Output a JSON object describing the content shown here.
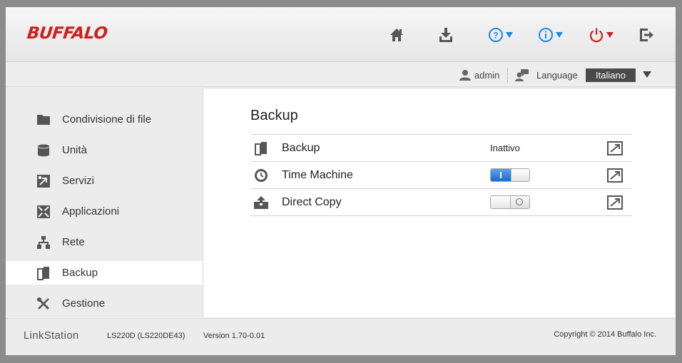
{
  "brand": {
    "logo_text": "BUFFALO",
    "accent_color": "#cc1f1f"
  },
  "header": {
    "icons": [
      "home-icon",
      "download-icon",
      "help-icon",
      "info-icon",
      "power-icon",
      "logout-icon"
    ],
    "link_color": "#1e88e5"
  },
  "userbar": {
    "user": "admin",
    "language_label": "Language",
    "language_value": "Italiano"
  },
  "sidebar": {
    "items": [
      {
        "label": "Condivisione di file",
        "icon": "folder-icon"
      },
      {
        "label": "Unità",
        "icon": "drive-icon"
      },
      {
        "label": "Servizi",
        "icon": "services-icon"
      },
      {
        "label": "Applicazioni",
        "icon": "applications-icon"
      },
      {
        "label": "Rete",
        "icon": "network-icon"
      },
      {
        "label": "Backup",
        "icon": "backup-icon",
        "active": true
      },
      {
        "label": "Gestione",
        "icon": "tools-icon"
      }
    ]
  },
  "main": {
    "title": "Backup",
    "rows": [
      {
        "label": "Backup",
        "status": "Inattivo",
        "icon": "backup-icon"
      },
      {
        "label": "Time Machine",
        "toggle": "on",
        "icon": "time-machine-icon"
      },
      {
        "label": "Direct Copy",
        "toggle": "off",
        "icon": "direct-copy-icon"
      }
    ]
  },
  "footer": {
    "brand": "LinkStation",
    "model": "LS220D (LS220DE43)",
    "version": "Version 1.70-0.01",
    "copyright": "Copyright © 2014 Buffalo Inc."
  }
}
